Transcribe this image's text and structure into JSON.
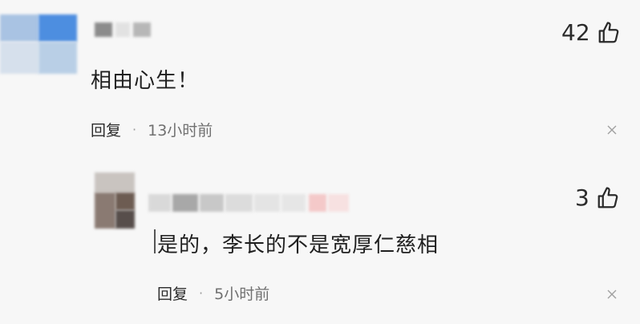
{
  "comments": [
    {
      "text": "相由心生！",
      "likes": "42",
      "reply_label": "回复",
      "separator": "·",
      "time": "13小时前"
    },
    {
      "text": "是的，李长的不是宽厚仁慈相",
      "likes": "3",
      "reply_label": "回复",
      "separator": "·",
      "time": "5小时前"
    }
  ],
  "icons": {
    "like": "thumbs-up-icon",
    "dismiss": "close-icon"
  },
  "colors": {
    "background": "#f7f7f7",
    "text": "#1f1f1f",
    "meta": "#707070"
  }
}
